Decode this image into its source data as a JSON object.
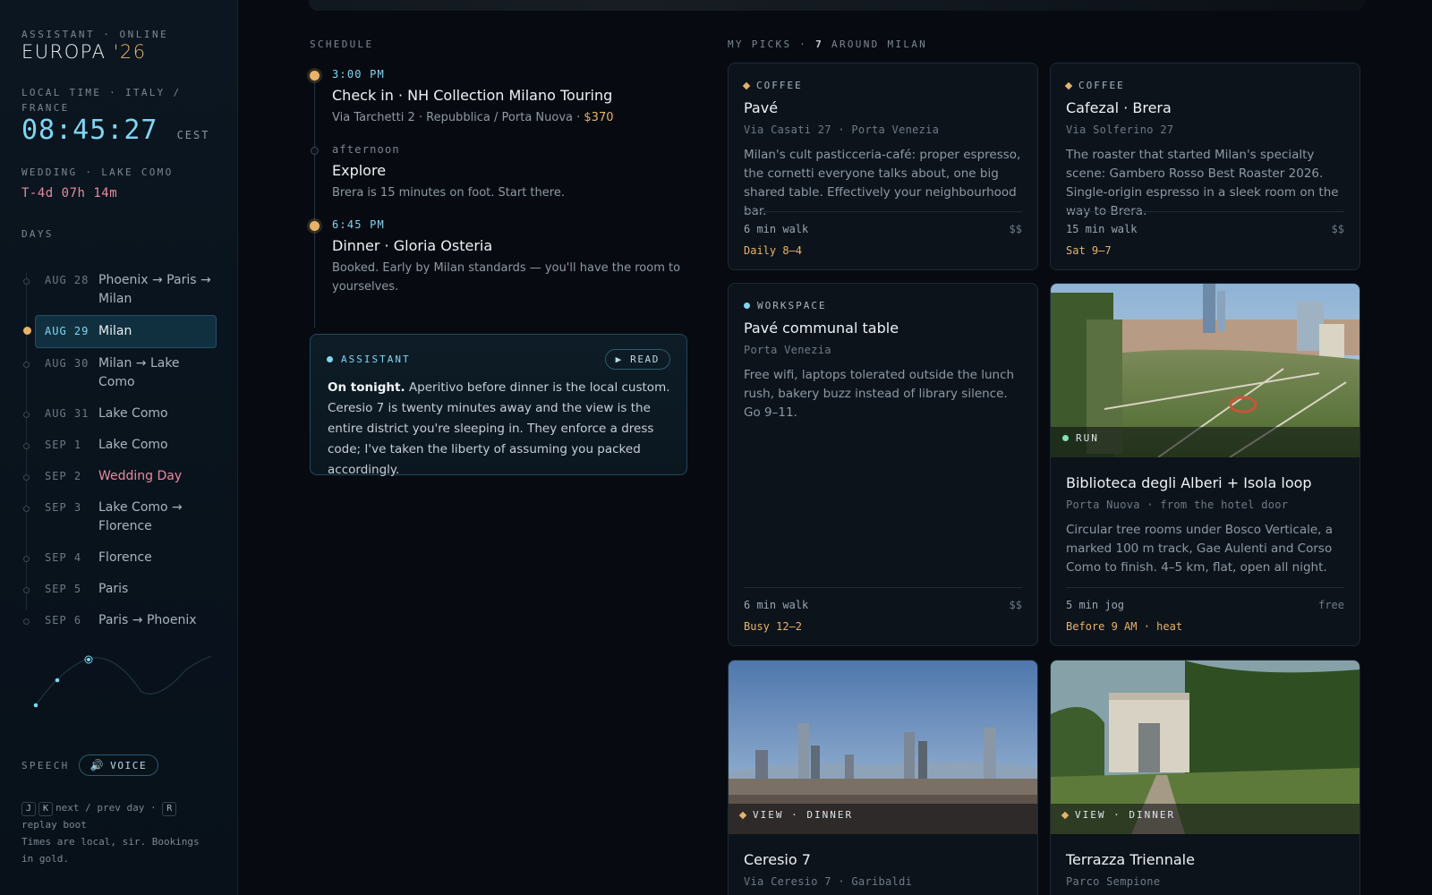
{
  "sidebar": {
    "status": "ASSISTANT · ONLINE",
    "brand_main": "EUROPA",
    "brand_year": "'26",
    "local_time_label": "LOCAL TIME · ITALY / FRANCE",
    "clock": "08:45:27",
    "tz": "CEST",
    "wedding_label": "WEDDING · LAKE COMO",
    "countdown": "T-4d 07h 14m",
    "days_label": "DAYS",
    "days": [
      {
        "date": "AUG 28",
        "place": "Phoenix → Paris → Milan"
      },
      {
        "date": "AUG 29",
        "place": "Milan"
      },
      {
        "date": "AUG 30",
        "place": "Milan → Lake Como"
      },
      {
        "date": "AUG 31",
        "place": "Lake Como"
      },
      {
        "date": "SEP 1",
        "place": "Lake Como"
      },
      {
        "date": "SEP 2",
        "place": "Wedding Day"
      },
      {
        "date": "SEP 3",
        "place": "Lake Como → Florence"
      },
      {
        "date": "SEP 4",
        "place": "Florence"
      },
      {
        "date": "SEP 5",
        "place": "Paris"
      },
      {
        "date": "SEP 6",
        "place": "Paris → Phoenix"
      }
    ],
    "active_day": "AUG 29",
    "speech_label": "SPEECH",
    "voice_button": "VOICE",
    "help": {
      "key1": "J",
      "key2": "K",
      "text1": "next / prev day ·",
      "key3": "R",
      "text2": "replay boot",
      "text3": "Times are local, sir. Bookings in gold."
    }
  },
  "schedule": {
    "label": "SCHEDULE",
    "events": [
      {
        "time": "3:00 PM",
        "title": "Check in · NH Collection Milano Touring",
        "sub": "Via Tarchetti 2 · Repubblica / Porta Nuova · ",
        "price": "$370"
      },
      {
        "time": "afternoon",
        "title": "Explore",
        "sub": "Brera is 15 minutes on foot. Start there."
      },
      {
        "time": "6:45 PM",
        "title": "Dinner · Gloria Osteria",
        "sub": "Booked. Early by Milan standards — you'll have the room to yourselves."
      }
    ]
  },
  "assistant": {
    "label": "ASSISTANT",
    "read_button": "▶ READ",
    "lead": "On tonight.",
    "body": " Aperitivo before dinner is the local custom. Ceresio 7 is twenty minutes away and the view is the entire district you're sleeping in. They enforce a dress code; I've taken the liberty of assuming you packed accordingly."
  },
  "picks": {
    "label_prefix": "MY PICKS · ",
    "count": "7",
    "label_suffix": " AROUND MILAN",
    "cards": [
      {
        "tag": "COFFEE",
        "name": "Pavé",
        "addr": "Via Casati 27 · Porta Venezia",
        "desc": "Milan's cult pasticceria-café: proper espresso, the cornetti everyone talks about, one big shared table. Effectively your neighbourhood bar.",
        "walk": "6 min walk",
        "cost": "$$",
        "hours": "Daily 8–4"
      },
      {
        "tag": "COFFEE",
        "name": "Cafezal · Brera",
        "addr": "Via Solferino 27",
        "desc": "The roaster that started Milan's specialty scene: Gambero Rosso Best Roaster 2026. Single-origin espresso in a sleek room on the way to Brera.",
        "walk": "15 min walk",
        "cost": "$$",
        "hours": "Sat 9–7"
      },
      {
        "tag": "WORKSPACE",
        "name": "Pavé communal table",
        "addr": "Porta Venezia",
        "desc": "Free wifi, laptops tolerated outside the lunch rush, bakery buzz instead of library silence. Go 9–11.",
        "walk": "6 min walk",
        "cost": "$$",
        "hours": "Busy 12–2"
      },
      {
        "tag": "RUN",
        "name": "Biblioteca degli Alberi + Isola loop",
        "addr": "Porta Nuova · from the hotel door",
        "desc": "Circular tree rooms under Bosco Verticale, a marked 100 m track, Gae Aulenti and Corso Como to finish. 4–5 km, flat, open all night.",
        "walk": "5 min jog",
        "cost": "free",
        "hours": "Before 9 AM · heat"
      },
      {
        "tag": "VIEW · DINNER",
        "name": "Ceresio 7",
        "addr": "Via Ceresio 7 · Garibaldi"
      },
      {
        "tag": "VIEW · DINNER",
        "name": "Terrazza Triennale",
        "addr": "Parco Sempione"
      }
    ]
  },
  "colors": {
    "accent_cyan": "#7fd6f2",
    "accent_gold": "#e9b26a",
    "wedding_pink": "#e88aa0",
    "bg": "#070b11"
  }
}
